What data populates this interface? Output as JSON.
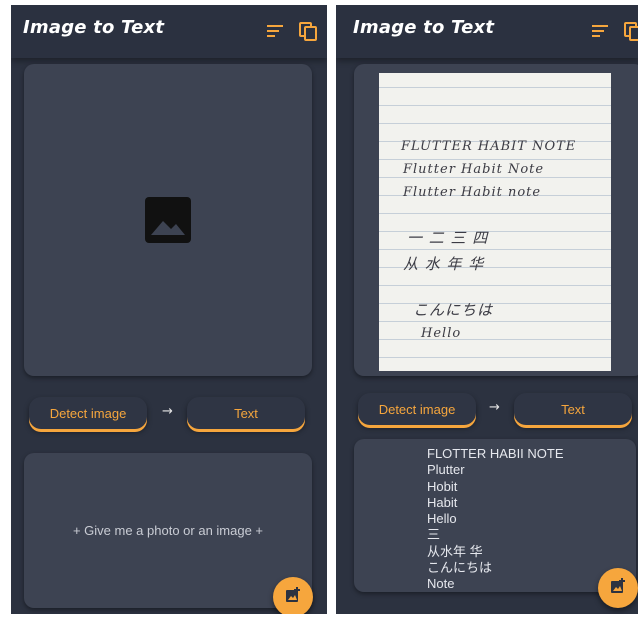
{
  "left": {
    "title": "Image to Text",
    "detect_label": "Detect image",
    "arrow": "→",
    "text_label": "Text",
    "placeholder": "+ Give me a photo or an image +"
  },
  "right": {
    "title": "Image to Text",
    "detect_label": "Detect image",
    "arrow": "→",
    "text_label": "Text",
    "result_lines": [
      "FLOTTER HABII NOTE",
      "Plutter",
      "Hobit",
      "Habit",
      "Hello",
      "三",
      "从水年 华",
      "こんにちは",
      "Note"
    ],
    "photo_handwriting": [
      "FLUTTER  HABIT  NOTE",
      "Flutter    Habit    Note",
      "Flutter    Habit    note",
      "一  二  三  四",
      "从  水   年   华",
      "こんにちは",
      "Hello"
    ]
  },
  "colors": {
    "background": "#2c3240",
    "panel": "#3d4352",
    "accent": "#f6a63d"
  },
  "icons": {
    "menu": "sort-lines-icon",
    "copy": "copy-icon",
    "image": "image-icon",
    "add_photo": "add-photo-icon"
  }
}
